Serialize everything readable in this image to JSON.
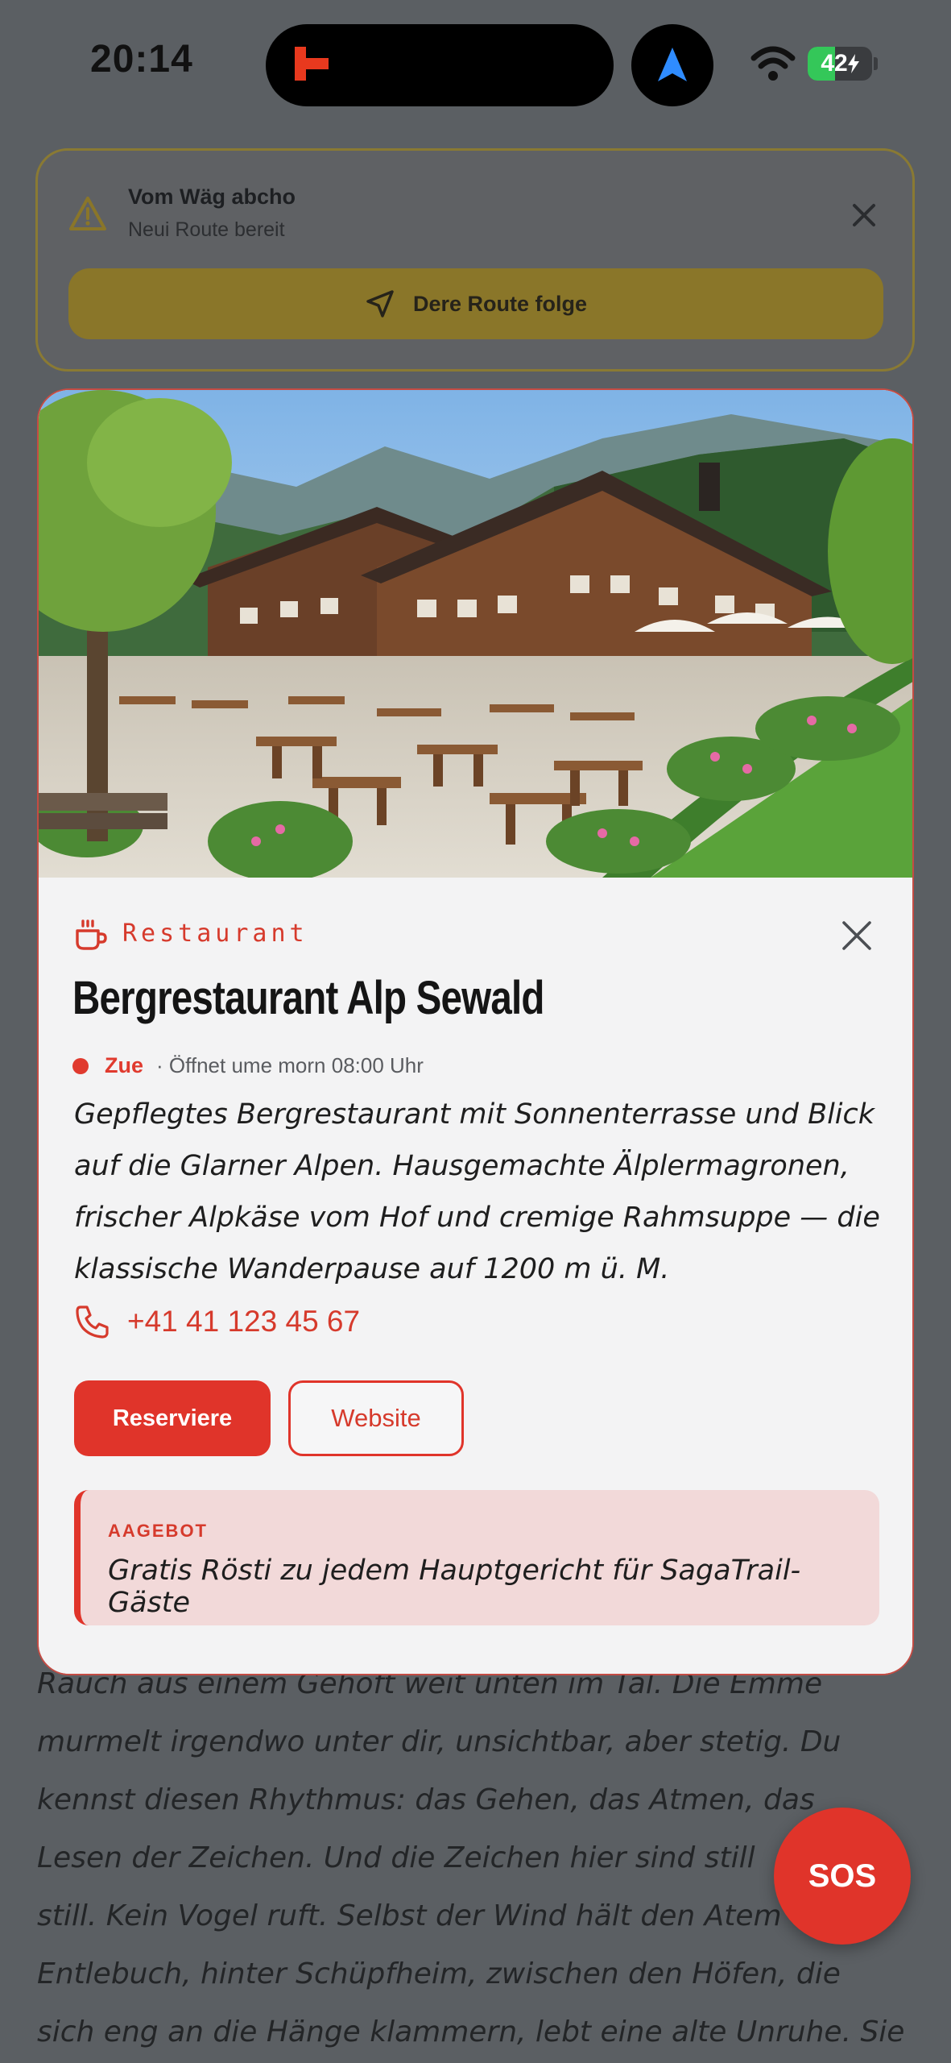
{
  "status_bar": {
    "time": "20:14",
    "battery_level": 42,
    "battery_text": "42",
    "icons": [
      "app-logo-icon",
      "navigation-arrow-icon",
      "wifi-icon",
      "battery-charging-icon"
    ]
  },
  "reroute_banner": {
    "title": "Vom Wäg abcho",
    "subtitle": "Neui Route bereit",
    "follow_button": "Dere Route folge",
    "icons": [
      "warning-icon",
      "close-icon",
      "navigation-icon"
    ]
  },
  "poi_card": {
    "category": "Restaurant",
    "title": "Bergrestaurant Alp Sewald",
    "status": "Zue",
    "hours": "· Öffnet ume morn 08:00 Uhr",
    "description": "Gepflegtes Bergrestaurant mit Sonnenterrasse und Blick auf die Glarner Alpen. Hausgemachte Älplermagronen, frischer Alpkäse vom Hof und cremige Rahmsuppe — die klassische Wanderpause auf 1200 m ü. M.",
    "phone": "+41 41 123 45 67",
    "reserve_button": "Reserviere",
    "website_button": "Website",
    "offer_label": "AAGEBOT",
    "offer_text": "Gratis Rösti zu jedem Hauptgericht für SagaTrail-Gäste",
    "icons": [
      "coffee-cup-icon",
      "close-icon",
      "phone-icon"
    ]
  },
  "story": {
    "lines": [
      "Rauch aus einem Gehöft weit unten im Tal. Die Emme",
      "murmelt irgendwo unter dir, unsichtbar, aber stetig. Du",
      "kennst diesen Rhythmus: das Gehen, das Atmen, das",
      "Lesen der Zeichen. Und die Zeichen hier sind still",
      "still. Kein Vogel ruft. Selbst der Wind hält den Atem",
      "Entlebuch, hinter Schüpfheim, zwischen den Höfen, die",
      "sich eng an die Hänge klammern, lebt eine alte Unruhe. Sie"
    ]
  },
  "sos_button": "SOS",
  "colors": {
    "accent": "#e0342a",
    "banner_gold": "#8a7629",
    "overlay": "#5b5f63"
  }
}
